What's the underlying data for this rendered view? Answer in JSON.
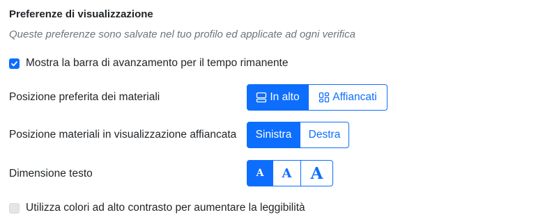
{
  "section": {
    "title": "Preferenze di visualizzazione",
    "subtitle": "Queste preferenze sono salvate nel tuo profilo ed applicate ad ogni verifica"
  },
  "progress_bar_option": {
    "label": "Mostra la barra di avanzamento per il tempo rimanente",
    "checked": true
  },
  "materials_position": {
    "label": "Posizione preferita dei materiali",
    "options": [
      {
        "label": "In alto",
        "icon": "layout-rows-icon",
        "active": true
      },
      {
        "label": "Affiancati",
        "icon": "layout-grid-icon",
        "active": false
      }
    ]
  },
  "side_by_side_position": {
    "label": "Posizione materiali in visualizzazione affiancata",
    "options": [
      {
        "label": "Sinistra",
        "active": true
      },
      {
        "label": "Destra",
        "active": false
      }
    ]
  },
  "text_size": {
    "label": "Dimensione testo",
    "options": [
      {
        "label": "A",
        "size": "small",
        "active": true
      },
      {
        "label": "A",
        "size": "medium",
        "active": false
      },
      {
        "label": "A",
        "size": "large",
        "active": false
      }
    ]
  },
  "high_contrast_option": {
    "label": "Utilizza colori ad alto contrasto per aumentare la leggibilità",
    "checked": false
  },
  "colors": {
    "accent": "#0d6efd",
    "text": "#212529",
    "muted": "#6c757d"
  }
}
